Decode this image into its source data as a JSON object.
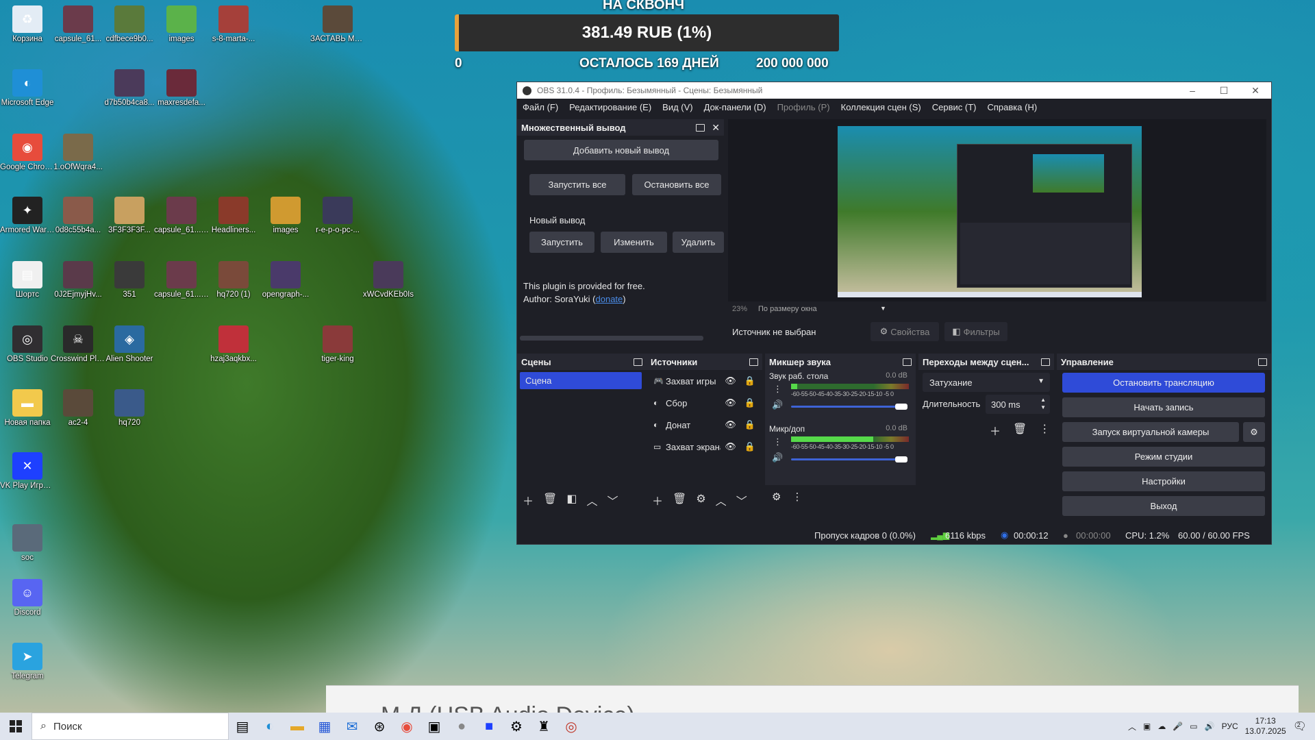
{
  "desktop_icons": [
    {
      "label": "Корзина",
      "icon": "recycle-bin-icon",
      "color": "#e3ecf5",
      "col": 0,
      "row": 0
    },
    {
      "label": "capsule_61...",
      "icon": "image-file-icon",
      "color": "#6b3b4b",
      "col": 1,
      "row": 0
    },
    {
      "label": "cdfbece9b0...",
      "icon": "image-file-icon",
      "color": "#5a7a3b",
      "col": 2,
      "row": 0
    },
    {
      "label": "images",
      "icon": "image-file-icon",
      "color": "#5bb24a",
      "col": 3,
      "row": 0
    },
    {
      "label": "s-8-marta-...",
      "icon": "image-file-icon",
      "color": "#a5403a",
      "col": 4,
      "row": 0
    },
    {
      "label": "ЗАСТАВЬ МЕНЯ СИЯ...",
      "icon": "image-file-icon",
      "color": "#5b4a3a",
      "col": 6,
      "row": 0
    },
    {
      "label": "Microsoft Edge",
      "icon": "edge-icon",
      "color": "#1f8fd6",
      "col": 0,
      "row": 1
    },
    {
      "label": "d7b50b4ca8...",
      "icon": "image-file-icon",
      "color": "#4b3a5a",
      "col": 2,
      "row": 1
    },
    {
      "label": "maxresdefa...",
      "icon": "image-file-icon",
      "color": "#6a2a3a",
      "col": 3,
      "row": 1
    },
    {
      "label": "Google Chrome",
      "icon": "chrome-icon",
      "color": "#e74c3c",
      "col": 0,
      "row": 2
    },
    {
      "label": "1.oOfWqra4...",
      "icon": "image-file-icon",
      "color": "#7a6a4a",
      "col": 1,
      "row": 2
    },
    {
      "label": "Armored Warfare",
      "icon": "armored-warfare-icon",
      "color": "#222222",
      "col": 0,
      "row": 3
    },
    {
      "label": "0d8c55b4a...",
      "icon": "image-file-icon",
      "color": "#8a5a4a",
      "col": 1,
      "row": 3
    },
    {
      "label": "3F3F3F3F...",
      "icon": "image-file-icon",
      "color": "#c8a060",
      "col": 2,
      "row": 3
    },
    {
      "label": "capsule_61... (1)",
      "icon": "image-file-icon",
      "color": "#6b3b4b",
      "col": 3,
      "row": 3
    },
    {
      "label": "Headliners...",
      "icon": "image-file-icon",
      "color": "#8a3a2a",
      "col": 4,
      "row": 3
    },
    {
      "label": "images",
      "icon": "image-file-icon",
      "color": "#d09a30",
      "col": 5,
      "row": 3
    },
    {
      "label": "r-e-p-o-pc-...",
      "icon": "image-file-icon",
      "color": "#3a3a5a",
      "col": 6,
      "row": 3
    },
    {
      "label": "Шортс",
      "icon": "document-icon",
      "color": "#f0f0f0",
      "col": 0,
      "row": 4
    },
    {
      "label": "0J2EjmyjHv...",
      "icon": "image-file-icon",
      "color": "#5a3a4a",
      "col": 1,
      "row": 4
    },
    {
      "label": "351",
      "icon": "image-file-icon",
      "color": "#3a3a3a",
      "col": 2,
      "row": 4
    },
    {
      "label": "capsule_61... — копия",
      "icon": "image-file-icon",
      "color": "#6b3b4b",
      "col": 3,
      "row": 4
    },
    {
      "label": "hq720 (1)",
      "icon": "image-file-icon",
      "color": "#7a4a3a",
      "col": 4,
      "row": 4
    },
    {
      "label": "opengraph-...",
      "icon": "image-file-icon",
      "color": "#4a3a6a",
      "col": 5,
      "row": 4
    },
    {
      "label": "xWCvdKEb0Is",
      "icon": "image-file-icon",
      "color": "#4a3a5a",
      "col": 7,
      "row": 4
    },
    {
      "label": "OBS Studio",
      "icon": "obs-icon",
      "color": "#302e31",
      "col": 0,
      "row": 5
    },
    {
      "label": "Crosswind Playtest",
      "icon": "crosswind-icon",
      "color": "#2a2a2a",
      "col": 1,
      "row": 5
    },
    {
      "label": "Alien Shooter",
      "icon": "alien-shooter-icon",
      "color": "#2a6aa0",
      "col": 2,
      "row": 5
    },
    {
      "label": "hzaj3aqkbx...",
      "icon": "image-file-icon",
      "color": "#c0303a",
      "col": 4,
      "row": 5
    },
    {
      "label": "tiger-king",
      "icon": "image-file-icon",
      "color": "#8a3a3a",
      "col": 6,
      "row": 5
    },
    {
      "label": "Новая папка",
      "icon": "folder-icon",
      "color": "#f2c94c",
      "col": 0,
      "row": 6
    },
    {
      "label": "ac2-4",
      "icon": "image-file-icon",
      "color": "#5a4a3a",
      "col": 1,
      "row": 6
    },
    {
      "label": "hq720",
      "icon": "image-file-icon",
      "color": "#3a5a8a",
      "col": 2,
      "row": 6
    },
    {
      "label": "VK Play Игров...",
      "icon": "vk-play-icon",
      "color": "#1e40ff",
      "col": 0,
      "row": 7
    },
    {
      "label": "soc",
      "icon": "image-file-icon",
      "color": "#5a6a7a",
      "col": 0,
      "row": 8
    },
    {
      "label": "Discord",
      "icon": "discord-icon",
      "color": "#5865f2",
      "col": 0,
      "row": 9
    },
    {
      "label": "Telegram",
      "icon": "telegram-icon",
      "color": "#2aa3df",
      "col": 0,
      "row": 10
    }
  ],
  "donation": {
    "heading": "НА СКВОНЧ",
    "amount": "381.49 RUB (1%)",
    "progress_percent": 1,
    "min": "0",
    "days_left": "ОСТАЛОСЬ 169 ДНЕЙ",
    "goal": "200 000 000",
    "bar_color": "#e8a23b"
  },
  "obs": {
    "title": "OBS 31.0.4 - Профиль: Безымянный - Сцены: Безымянный",
    "menu": [
      "Файл (F)",
      "Редактирование (E)",
      "Вид (V)",
      "Док-панели (D)",
      "Профиль (P)",
      "Коллекция сцен (S)",
      "Сервис (T)",
      "Справка (H)"
    ],
    "multi_output": {
      "title": "Множественный вывод",
      "add_output": "Добавить новый вывод",
      "start_all": "Запустить все",
      "stop_all": "Остановить все",
      "new_output_label": "Новый вывод",
      "start": "Запустить",
      "edit": "Изменить",
      "delete": "Удалить",
      "plugin_note": "This plugin is provided for free.",
      "author_prefix": "Author: SoraYuki (",
      "donate_link": "donate",
      "author_suffix": ")"
    },
    "preview": {
      "zoom": "23%",
      "fit_mode": "По размеру окна"
    },
    "source_bar": {
      "no_source": "Источник не выбран",
      "properties": "Свойства",
      "filters": "Фильтры"
    },
    "scenes": {
      "title": "Сцены",
      "items": [
        "Сцена"
      ]
    },
    "sources": {
      "title": "Источники",
      "items": [
        {
          "name": "Захват игры",
          "icon": "game-capture-icon"
        },
        {
          "name": "Сбор",
          "icon": "browser-source-icon"
        },
        {
          "name": "Донат",
          "icon": "browser-source-icon"
        },
        {
          "name": "Захват экрана",
          "icon": "display-capture-icon"
        }
      ]
    },
    "mixer": {
      "title": "Микшер звука",
      "channels": [
        {
          "name": "Звук раб. стола",
          "db": "0.0 dB",
          "level": 0.05
        },
        {
          "name": "Микр/доп",
          "db": "0.0 dB",
          "level": 0.7
        }
      ],
      "scale": "-60-55-50-45-40-35-30-25-20-15-10 -5  0"
    },
    "transitions": {
      "title": "Переходы между сцен...",
      "selected": "Затухание",
      "duration_label": "Длительность",
      "duration": "300 ms"
    },
    "controls": {
      "title": "Управление",
      "stop_stream": "Остановить трансляцию",
      "start_record": "Начать запись",
      "virtual_cam": "Запуск виртуальной камеры",
      "studio_mode": "Режим студии",
      "settings": "Настройки",
      "exit": "Выход",
      "accent": "#2f4bd8"
    },
    "status": {
      "dropped": "Пропуск кадров 0 (0.0%)",
      "bitrate": "6116 kbps",
      "stream_time": "00:00:12",
      "record_time": "00:00:00",
      "cpu": "CPU: 1.2%",
      "fps": "60.00 / 60.00 FPS"
    }
  },
  "bottom_window": {
    "title": "М                   Д                  (USB Audio Device)"
  },
  "taskbar": {
    "search_placeholder": "Поиск",
    "lang": "РУС",
    "time": "17:13",
    "date": "13.07.2025",
    "notifications": "2"
  }
}
